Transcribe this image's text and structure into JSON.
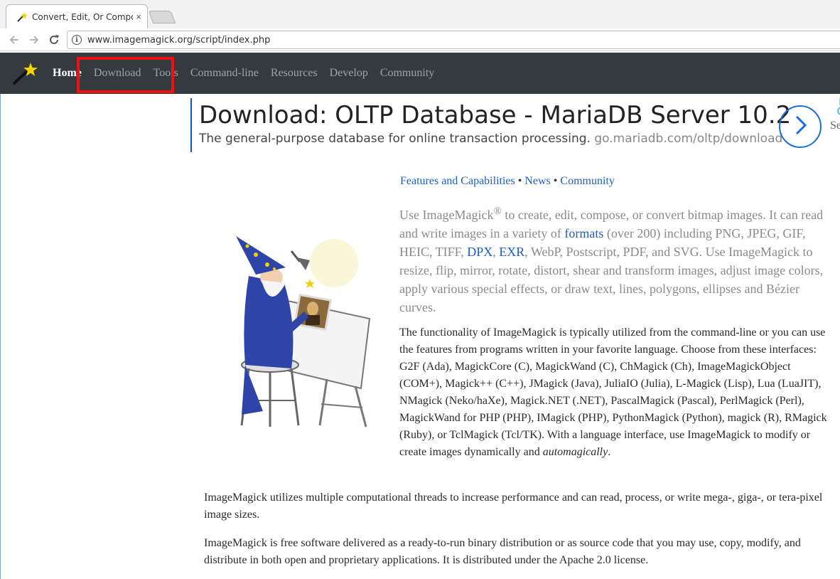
{
  "browser": {
    "tab_title": "Convert, Edit, Or Compos",
    "tab_close": "×",
    "url": "www.imagemagick.org/script/index.php",
    "back_icon": "arrow-left-icon",
    "forward_icon": "arrow-right-icon",
    "reload_icon": "reload-icon",
    "info_icon": "info-icon"
  },
  "navbar": {
    "logo_icon": "wizard-wand-logo",
    "items": [
      {
        "label": "Home",
        "active": true
      },
      {
        "label": "Download",
        "active": false
      },
      {
        "label": "Tools",
        "active": false
      },
      {
        "label": "Command-line",
        "active": false
      },
      {
        "label": "Resources",
        "active": false
      },
      {
        "label": "Develop",
        "active": false
      },
      {
        "label": "Community",
        "active": false
      }
    ],
    "search_partial": "Se",
    "highlight_color": "#ee1111"
  },
  "ad": {
    "title": "Download: OLTP Database - MariaDB Server 10.2",
    "description": "The general-purpose database for online transaction processing.",
    "url": "go.mariadb.com/oltp/download",
    "arrow_icon": "chevron-right-icon"
  },
  "feature_links": {
    "features": "Features and Capabilities",
    "sep1": " • ",
    "news": "News",
    "sep2": " • ",
    "community": "Community"
  },
  "lead": {
    "t1": "Use ImageMagick",
    "reg": "®",
    "t2": " to create, edit, compose, or convert bitmap images. It can read and write images in a variety of ",
    "formats": "formats",
    "t3": " (over 200) including PNG, JPEG, GIF, HEIC, TIFF, ",
    "dpx": "DPX",
    "t4": ", ",
    "exr": "EXR",
    "t5": ", WebP, Postscript, PDF, and SVG. Use ImageMagick to resize, flip, mirror, rotate, distort, shear and transform images, adjust image colors, apply various special effects, or draw text, lines, polygons, ellipses and Bézier curves."
  },
  "para1": {
    "t1": "The functionality of ImageMagick is typically utilized from the ",
    "command_line": "command-line",
    "t2": " or you can use the features from programs written in your favorite language. Choose from these interfaces: ",
    "g2f": "G2F",
    "t3": " (Ada), ",
    "magickcore": "MagickCore",
    "t4": " (C), ",
    "magickwand": "MagickWand",
    "t5": " (C), ",
    "chmagick": "ChMagick",
    "t6": " (Ch), ",
    "imagemagickobject": "ImageMagickObject",
    "t7": " (COM+), ",
    "magickpp": "Magick++",
    "t8": " (C++), ",
    "jmagick": "JMagick",
    "t9": " (Java), ",
    "juliaio": "JuliaIO",
    "t10": " (Julia), ",
    "lmagick": "L-Magick",
    "t11": " (Lisp), ",
    "lua": "Lua",
    "t12": " (LuaJIT), ",
    "nmagick": "NMagick",
    "t13": " (Neko/haXe), ",
    "magicknet": "Magick.NET",
    "t14": " (.NET), ",
    "pascalmagick": "PascalMagick",
    "t15": " (Pascal), ",
    "perlmagick": "PerlMagick",
    "t16": " (Perl), ",
    "magickwandphp": "MagickWand for PHP",
    "t17": " (PHP), ",
    "imagick": "IMagick",
    "t18": " (PHP), ",
    "pythonmagick": "PythonMagick",
    "t19": " (Python), ",
    "magick_r": "magick",
    "t20": " (R), ",
    "rmagick": "RMagick",
    "t21": " (Ruby), or ",
    "tclmagick": "TclMagick",
    "t22": " (Tcl/TK). With a language interface, use ImageMagick to modify or create images dynamically and ",
    "automagically": "automagically",
    "t23": "."
  },
  "para2": {
    "text": "ImageMagick utilizes multiple computational threads to increase performance and can read, process, or write mega-, giga-, or tera-pixel image sizes."
  },
  "para3": {
    "t1": "ImageMagick is free software delivered as a ready-to-run binary distribution or as source code that you may use, copy, modify, and distribute in both open and proprietary applications. It is distributed under the Apache 2.0 ",
    "license": "license",
    "t2": "."
  },
  "colors": {
    "navbar_bg": "#343a40",
    "link": "#1a5fc8",
    "lead_text": "#8a8a8a",
    "ad_accent": "#1a6fd8"
  }
}
